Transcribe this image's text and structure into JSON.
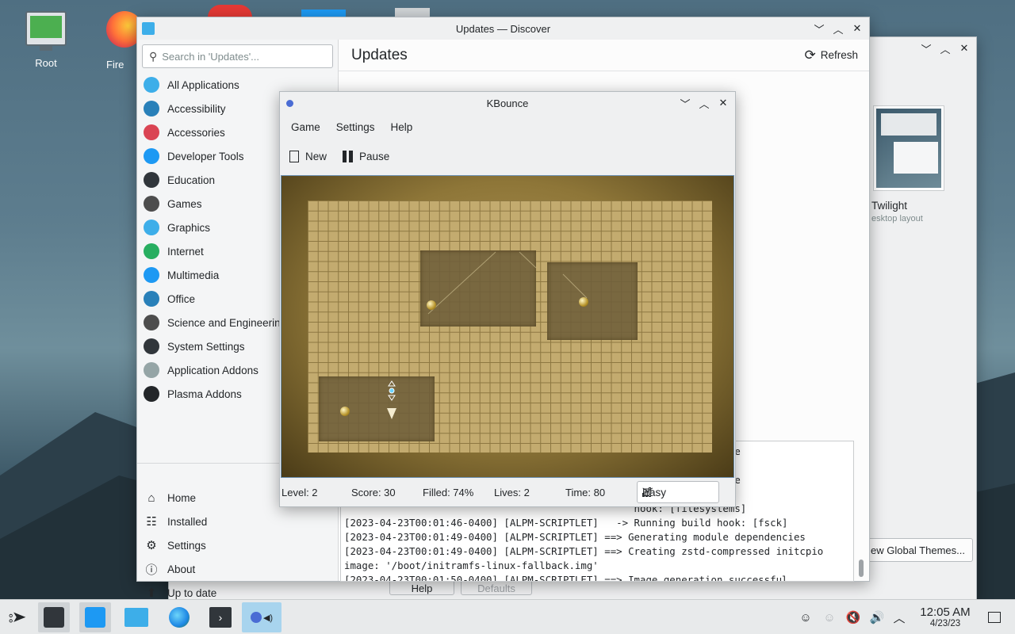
{
  "desktop": {
    "icons": [
      {
        "label": "Root"
      },
      {
        "label": "Fire"
      }
    ]
  },
  "settings": {
    "theme_name": "Twilight",
    "theme_desc": "esktop layout",
    "new_themes_button": "ew Global Themes...",
    "help_button": "Help",
    "defaults_button": "Defaults"
  },
  "discover": {
    "title": "Updates — Discover",
    "search_placeholder": "Search in 'Updates'...",
    "categories": [
      {
        "label": "All Applications",
        "color": "#3daee9"
      },
      {
        "label": "Accessibility",
        "color": "#2980b9"
      },
      {
        "label": "Accessories",
        "color": "#da4453"
      },
      {
        "label": "Developer Tools",
        "color": "#1d99f3"
      },
      {
        "label": "Education",
        "color": "#31363b"
      },
      {
        "label": "Games",
        "color": "#4d4d4d"
      },
      {
        "label": "Graphics",
        "color": "#3daee9"
      },
      {
        "label": "Internet",
        "color": "#27ae60"
      },
      {
        "label": "Multimedia",
        "color": "#1d99f3"
      },
      {
        "label": "Office",
        "color": "#2980b9"
      },
      {
        "label": "Science and Engineering",
        "color": "#4d4d4d"
      },
      {
        "label": "System Settings",
        "color": "#31363b"
      },
      {
        "label": "Application Addons",
        "color": "#95a5a6"
      },
      {
        "label": "Plasma Addons",
        "color": "#232629"
      }
    ],
    "nav": [
      {
        "label": "Home",
        "icon": "home-icon",
        "glyph": "⌂"
      },
      {
        "label": "Installed",
        "icon": "installed-icon",
        "glyph": "☷"
      },
      {
        "label": "Settings",
        "icon": "settings-icon",
        "glyph": "⚙"
      },
      {
        "label": "About",
        "icon": "about-icon",
        "glyph": "ⓘ"
      },
      {
        "label": "Up to date",
        "icon": "up-to-date-icon",
        "glyph": "⬆"
      }
    ],
    "page_title": "Updates",
    "refresh_label": "Refresh",
    "log_lines": [
      "                                                 y missing firmware",
      "",
      "                                                 y missing firmware",
      "",
      "                                                 hook: [filesystems]",
      "[2023-04-23T00:01:46-0400] [ALPM-SCRIPTLET]   -> Running build hook: [fsck]",
      "[2023-04-23T00:01:49-0400] [ALPM-SCRIPTLET] ==> Generating module dependencies",
      "[2023-04-23T00:01:49-0400] [ALPM-SCRIPTLET] ==> Creating zstd-compressed initcpio",
      "image: '/boot/initramfs-linux-fallback.img'",
      "[2023-04-23T00:01:50-0400] [ALPM-SCRIPTLET] ==> Image generation successful"
    ]
  },
  "kbounce": {
    "title": "KBounce",
    "menu": [
      "Game",
      "Settings",
      "Help"
    ],
    "toolbar": {
      "new_label": "New",
      "pause_label": "Pause"
    },
    "status": {
      "level": "Level: 2",
      "score": "Score: 30",
      "filled": "Filled: 74%",
      "lives": "Lives: 2",
      "time": "Time: 80"
    },
    "difficulty": "Easy"
  },
  "taskbar": {
    "time": "12:05 AM",
    "date": "4/23/23"
  }
}
